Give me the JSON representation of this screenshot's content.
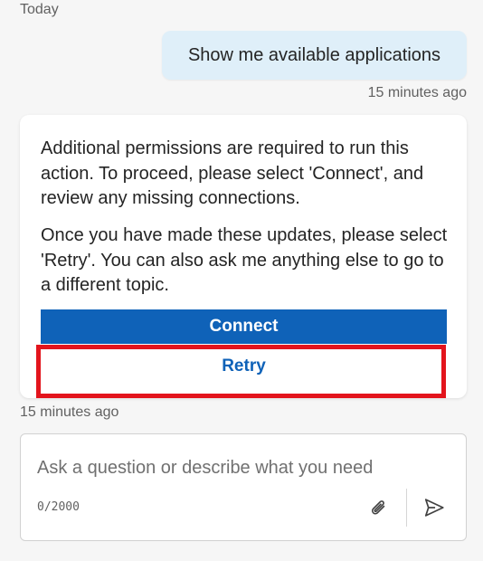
{
  "chat": {
    "date_label": "Today",
    "user_message": "Show me available applications",
    "user_time": "15 minutes ago",
    "bot_paragraph_1": "Additional permissions are required to run this action. To proceed, please select 'Connect', and review any missing connections.",
    "bot_paragraph_2": "Once you have made these updates, please select 'Retry'. You can also ask me anything else to go to a different topic.",
    "connect_label": "Connect",
    "retry_label": "Retry",
    "bot_time": "15 minutes ago"
  },
  "composer": {
    "placeholder": "Ask a question or describe what you need",
    "char_count": "0/2000",
    "attach_icon": "paperclip-icon",
    "send_icon": "send-icon"
  },
  "colors": {
    "accent": "#0f62b8",
    "user_bubble": "#dfeff9",
    "highlight": "#e3141c",
    "background": "#f6f6f6"
  }
}
